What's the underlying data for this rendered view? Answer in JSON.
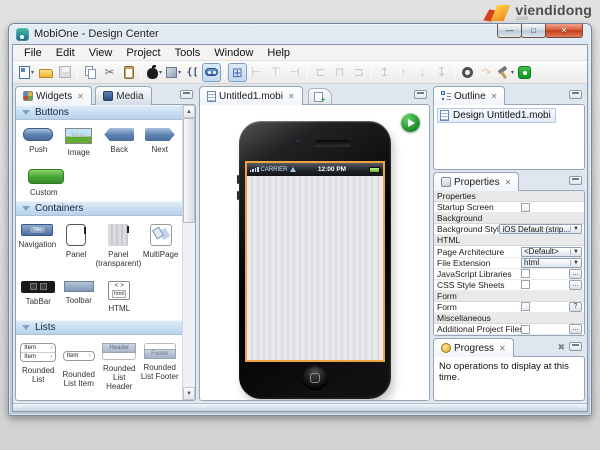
{
  "watermark": {
    "brand": "viendidong",
    "domain": ".com"
  },
  "window": {
    "title": "MobiOne - Design Center"
  },
  "menu": {
    "items": [
      "File",
      "Edit",
      "View",
      "Project",
      "Tools",
      "Window",
      "Help"
    ]
  },
  "toolbar": {
    "icons": [
      "new-file",
      "open-folder",
      "save",
      "copy",
      "cut",
      "paste",
      "build-ios",
      "package",
      "source-code",
      "widgets-preview",
      "grid-layout",
      "align-left",
      "align-center",
      "align-right",
      "distribute-left",
      "distribute-center",
      "distribute-right",
      "bring-to-front",
      "move-up",
      "move-down",
      "send-to-back",
      "settings",
      "deploy",
      "build",
      "test-center"
    ]
  },
  "widgets_panel": {
    "tabs": [
      {
        "label": "Widgets"
      },
      {
        "label": "Media"
      }
    ],
    "sections": {
      "buttons": "Buttons",
      "containers": "Containers",
      "lists": "Lists"
    },
    "buttons": {
      "push": {
        "label": "Push"
      },
      "image": {
        "label": "Image",
        "thumb_text": "Button"
      },
      "back": {
        "label": "Back"
      },
      "next": {
        "label": "Next"
      },
      "custom": {
        "label": "Custom"
      }
    },
    "containers": {
      "navigation": {
        "label": "Navigation",
        "thumb_text": "Title"
      },
      "panel": {
        "label": "Panel"
      },
      "panel_transparent": {
        "label": "Panel (transparent)"
      },
      "multipage": {
        "label": "MultiPage"
      },
      "tabbar": {
        "label": "TabBar"
      },
      "toolbar": {
        "label": "Toolbar"
      },
      "html": {
        "label": "HTML",
        "thumb_tag": "< >",
        "thumb_text": "html"
      }
    },
    "lists": {
      "rounded_list": {
        "label": "Rounded List",
        "item": "Item",
        "chev": "›"
      },
      "rounded_list_item": {
        "label": "Rounded List Item",
        "item": "Item",
        "chev": "›"
      },
      "rounded_list_header": {
        "label": "Rounded List Header",
        "thumb_text": "Header"
      },
      "rounded_list_footer": {
        "label": "Rounded List Footer",
        "thumb_text": "Footer"
      },
      "partial_item1": {
        "thumb_text": "Item 1",
        "chev": "›"
      },
      "partial_item": {
        "thumb_text": "Item",
        "chev": "›"
      },
      "partial_header": {
        "thumb_text": "Header"
      }
    }
  },
  "editor": {
    "tab_label": "Untitled1.mobi",
    "phone": {
      "carrier": "CARRIER",
      "time": "12:00 PM"
    }
  },
  "outline": {
    "tab_label": "Outline",
    "item": "Design Untitled1.mobi"
  },
  "properties": {
    "tab_label": "Properties",
    "buttons": {
      "browse": "...",
      "help": "?"
    },
    "rows": [
      {
        "type": "section",
        "label": "Properties"
      },
      {
        "type": "checkbox",
        "label": "Startup Screen",
        "checked": false
      },
      {
        "type": "section",
        "label": "Background"
      },
      {
        "type": "dropdown",
        "label": "Background Style",
        "value": "iOS Default (strip..."
      },
      {
        "type": "section",
        "label": "HTML"
      },
      {
        "type": "dropdown",
        "label": "Page Architecture",
        "value": "<Default>"
      },
      {
        "type": "dropdown",
        "label": "File Extension",
        "value": "html"
      },
      {
        "type": "picker",
        "label": "JavaScript Libraries",
        "value": ""
      },
      {
        "type": "picker",
        "label": "CSS Style Sheets",
        "value": ""
      },
      {
        "type": "section",
        "label": "Form"
      },
      {
        "type": "checkbox-help",
        "label": "Form",
        "checked": false
      },
      {
        "type": "section",
        "label": "Miscellaneous"
      },
      {
        "type": "picker",
        "label": "Additional Project Files",
        "value": ""
      }
    ]
  },
  "progress": {
    "tab_label": "Progress",
    "message": "No operations to display at this time."
  },
  "colors": {
    "accent_selection": "#eda33e",
    "section_header": "#b9d2ea",
    "battery": "#63bf27",
    "close_button": "#c13a17",
    "play_button": "#1b8a24"
  }
}
